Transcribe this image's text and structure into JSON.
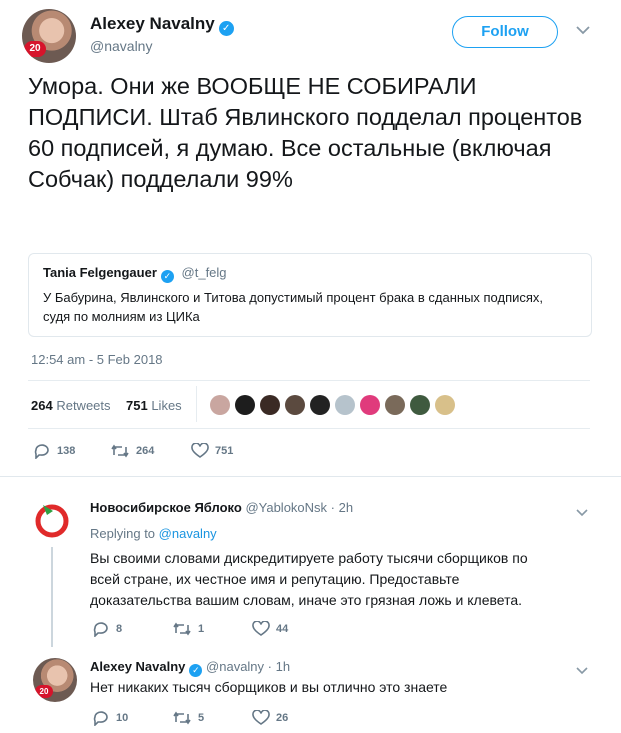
{
  "tweet": {
    "author_name": "Alexey Navalny",
    "author_handle": "@navalny",
    "avatar_badge": "20",
    "follow_label": "Follow",
    "text": "Умора. Они же ВООБЩЕ НЕ СОБИРАЛИ ПОДПИСИ. Штаб Явлинского подделал процентов 60 подписей, я думаю. Все остальные (включая Собчак) подделали 99%",
    "quote": {
      "author_name": "Tania Felgengauer",
      "author_handle": "@t_felg",
      "text": "У Бабурина, Явлинского и Титова допустимый процент брака в сданных подписях, судя по молниям из ЦИКа"
    },
    "timestamp": "12:54 am - 5 Feb 2018",
    "retweets_count": "264",
    "retweets_label": "Retweets",
    "likes_count": "751",
    "likes_label": "Likes",
    "actions": {
      "replies": "138",
      "retweets": "264",
      "likes": "751"
    }
  },
  "replies": [
    {
      "author_name": "Новосибирское Яблоко",
      "author_handle": "@YablokoNsk",
      "time": "2h",
      "replying_to_label": "Replying to",
      "replying_to_handle": "@navalny",
      "text": "Вы своими словами дискредитируете работу тысячи сборщиков по всей стране, их честное имя и репутацию. Предоставьте доказательства вашим словам, иначе это грязная ложь и клевета.",
      "replies": "8",
      "retweets": "1",
      "likes": "44"
    },
    {
      "author_name": "Alexey Navalny",
      "author_handle": "@navalny",
      "time": "1h",
      "text": "Нет никаких тысяч сборщиков и вы отлично это знаете",
      "replies": "10",
      "retweets": "5",
      "likes": "26"
    }
  ],
  "colors": {
    "accent": "#1da1f2",
    "link": "#1b95e0",
    "muted": "#657786",
    "badge_red": "#d6142b",
    "yabloko_green": "#2ea043"
  }
}
